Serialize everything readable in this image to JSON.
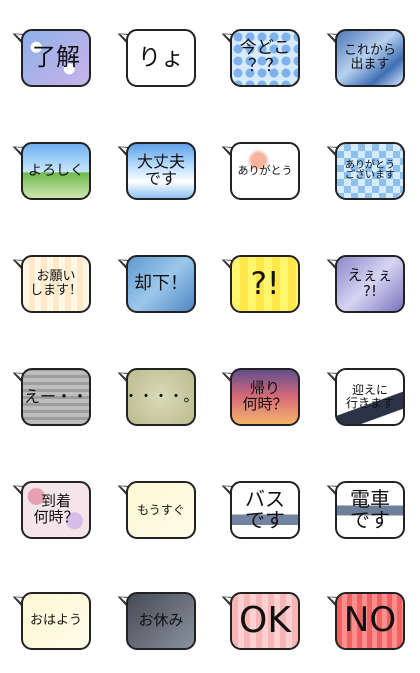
{
  "stickers": [
    {
      "text": "了解",
      "theme": "bg-blue-star",
      "font_size": 24
    },
    {
      "text": "りょ",
      "theme": "bg-white",
      "font_size": 23
    },
    {
      "text": "今どこ\n？？",
      "theme": "bg-dots",
      "font_size": 17
    },
    {
      "text": "これから\n出ます",
      "theme": "bg-wave",
      "font_size": 13
    },
    {
      "text": "よろしく",
      "theme": "bg-sky-green",
      "font_size": 14
    },
    {
      "text": "大丈夫\nです",
      "theme": "bg-sky",
      "font_size": 16
    },
    {
      "text": "ありがとう",
      "theme": "bg-swirl",
      "font_size": 11
    },
    {
      "text": "ありがとう\nございます",
      "theme": "bg-check",
      "font_size": 10
    },
    {
      "text": "お願い\nします！",
      "theme": "bg-cream",
      "font_size": 13
    },
    {
      "text": "却下！",
      "theme": "bg-ice",
      "font_size": 18
    },
    {
      "text": "?!",
      "theme": "bg-yellow",
      "font_size": 31
    },
    {
      "text": "えぇぇ\n?!",
      "theme": "bg-purple",
      "font_size": 15
    },
    {
      "text": "えー・・",
      "theme": "bg-gray",
      "font_size": 16
    },
    {
      "text": "・・・・。",
      "theme": "bg-olive",
      "font_size": 15
    },
    {
      "text": "帰り\n何時？",
      "theme": "bg-sunset",
      "font_size": 15
    },
    {
      "text": "迎えに\n行きます",
      "theme": "bg-road",
      "font_size": 12
    },
    {
      "text": "到着\n何時？",
      "theme": "bg-flower",
      "font_size": 15
    },
    {
      "text": "もうすぐ",
      "theme": "bg-soft-yellow",
      "font_size": 12
    },
    {
      "text": "バス\nです",
      "theme": "bg-bus",
      "font_size": 20
    },
    {
      "text": "電車\nです",
      "theme": "bg-train",
      "font_size": 20
    },
    {
      "text": "おはよう",
      "theme": "bg-soft-yellow",
      "font_size": 13
    },
    {
      "text": "お休み",
      "theme": "bg-dark",
      "font_size": 15
    },
    {
      "text": "OK",
      "theme": "bg-pink-grid",
      "font_size": 36
    },
    {
      "text": "NO",
      "theme": "bg-red-grid",
      "font_size": 34
    }
  ]
}
